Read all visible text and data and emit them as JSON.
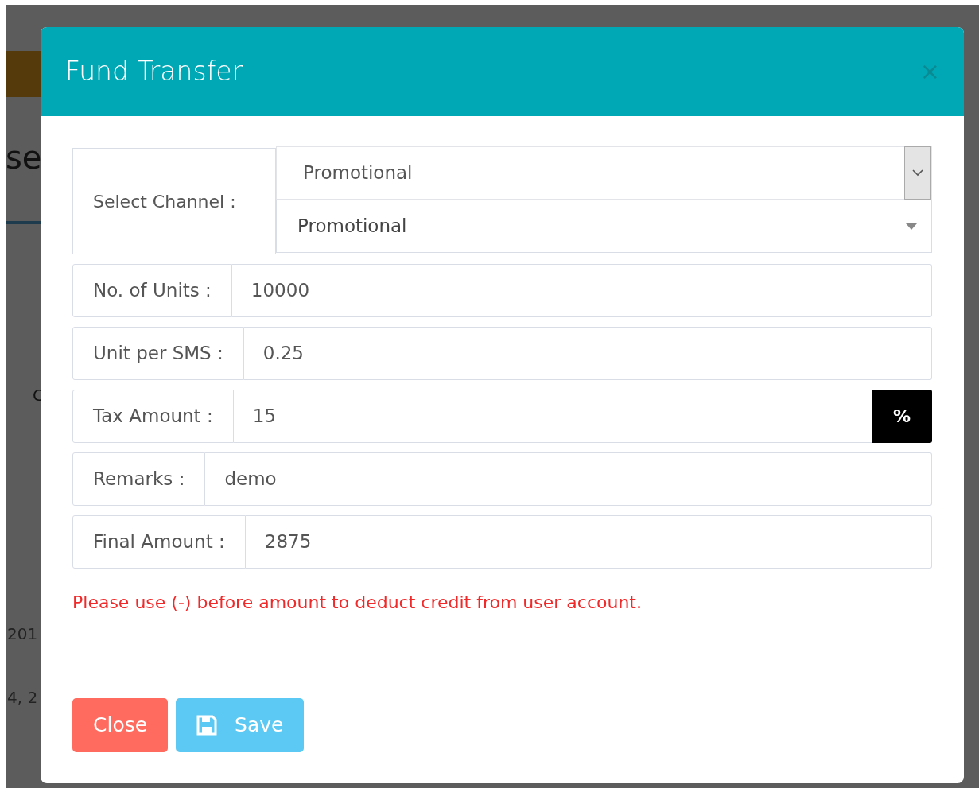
{
  "backdrop": {
    "texts": [
      "se",
      "C",
      "201",
      "4, 2"
    ]
  },
  "modal": {
    "title": "Fund Transfer",
    "close_symbol": "×"
  },
  "channel": {
    "label": "Select Channel :",
    "native_value": "Promotional",
    "styled_value": "Promotional"
  },
  "fields": [
    {
      "label": "No. of Units :",
      "value": "10000"
    },
    {
      "label": "Unit per SMS :",
      "value": "0.25"
    },
    {
      "label": "Tax Amount :",
      "value": "15",
      "addon": "%"
    },
    {
      "label": "Remarks :",
      "value": "demo"
    },
    {
      "label": "Final Amount :",
      "value": "2875"
    }
  ],
  "note": "Please use (-) before amount to deduct credit from user account.",
  "buttons": [
    {
      "kind": "close",
      "label": "Close"
    },
    {
      "kind": "save",
      "label": "Save"
    }
  ]
}
